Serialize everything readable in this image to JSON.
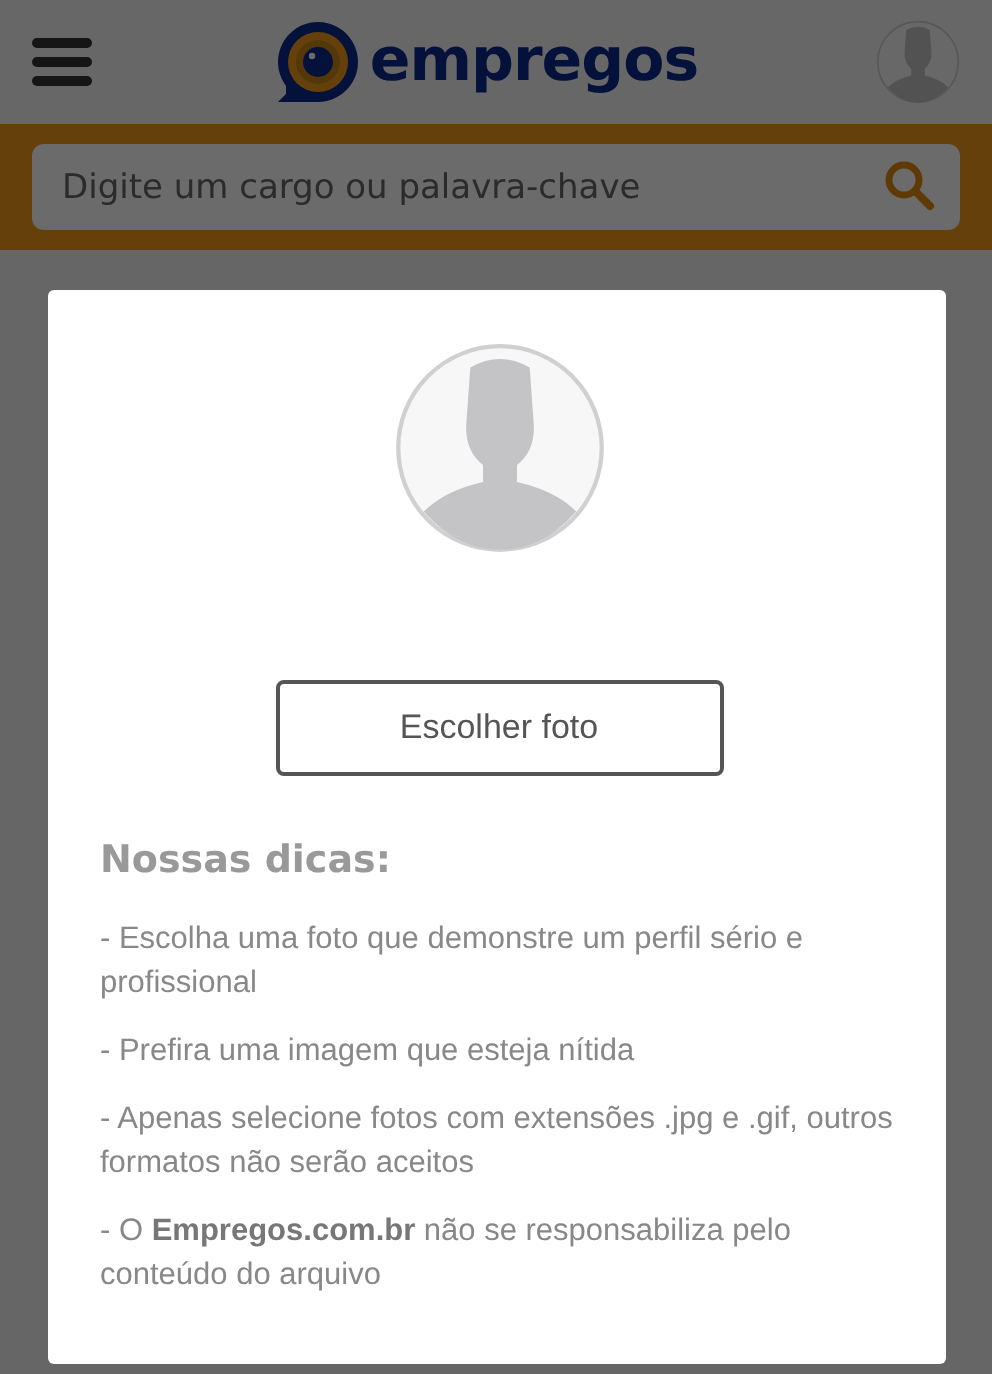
{
  "header": {
    "logo": "empregos"
  },
  "search": {
    "placeholder": "Digite um cargo ou palavra-chave"
  },
  "modal": {
    "button": "Escolher foto",
    "tips_title": "Nossas dicas:",
    "tips": [
      "- Escolha uma foto que demonstre um perfil sério e profissional",
      "- Prefira uma imagem que esteja nítida",
      "- Apenas selecione fotos com extensões .jpg e .gif, outros formatos não serão aceitos",
      "- O **Empregos.com.br** não se responsabiliza pelo conteúdo do arquivo"
    ]
  }
}
